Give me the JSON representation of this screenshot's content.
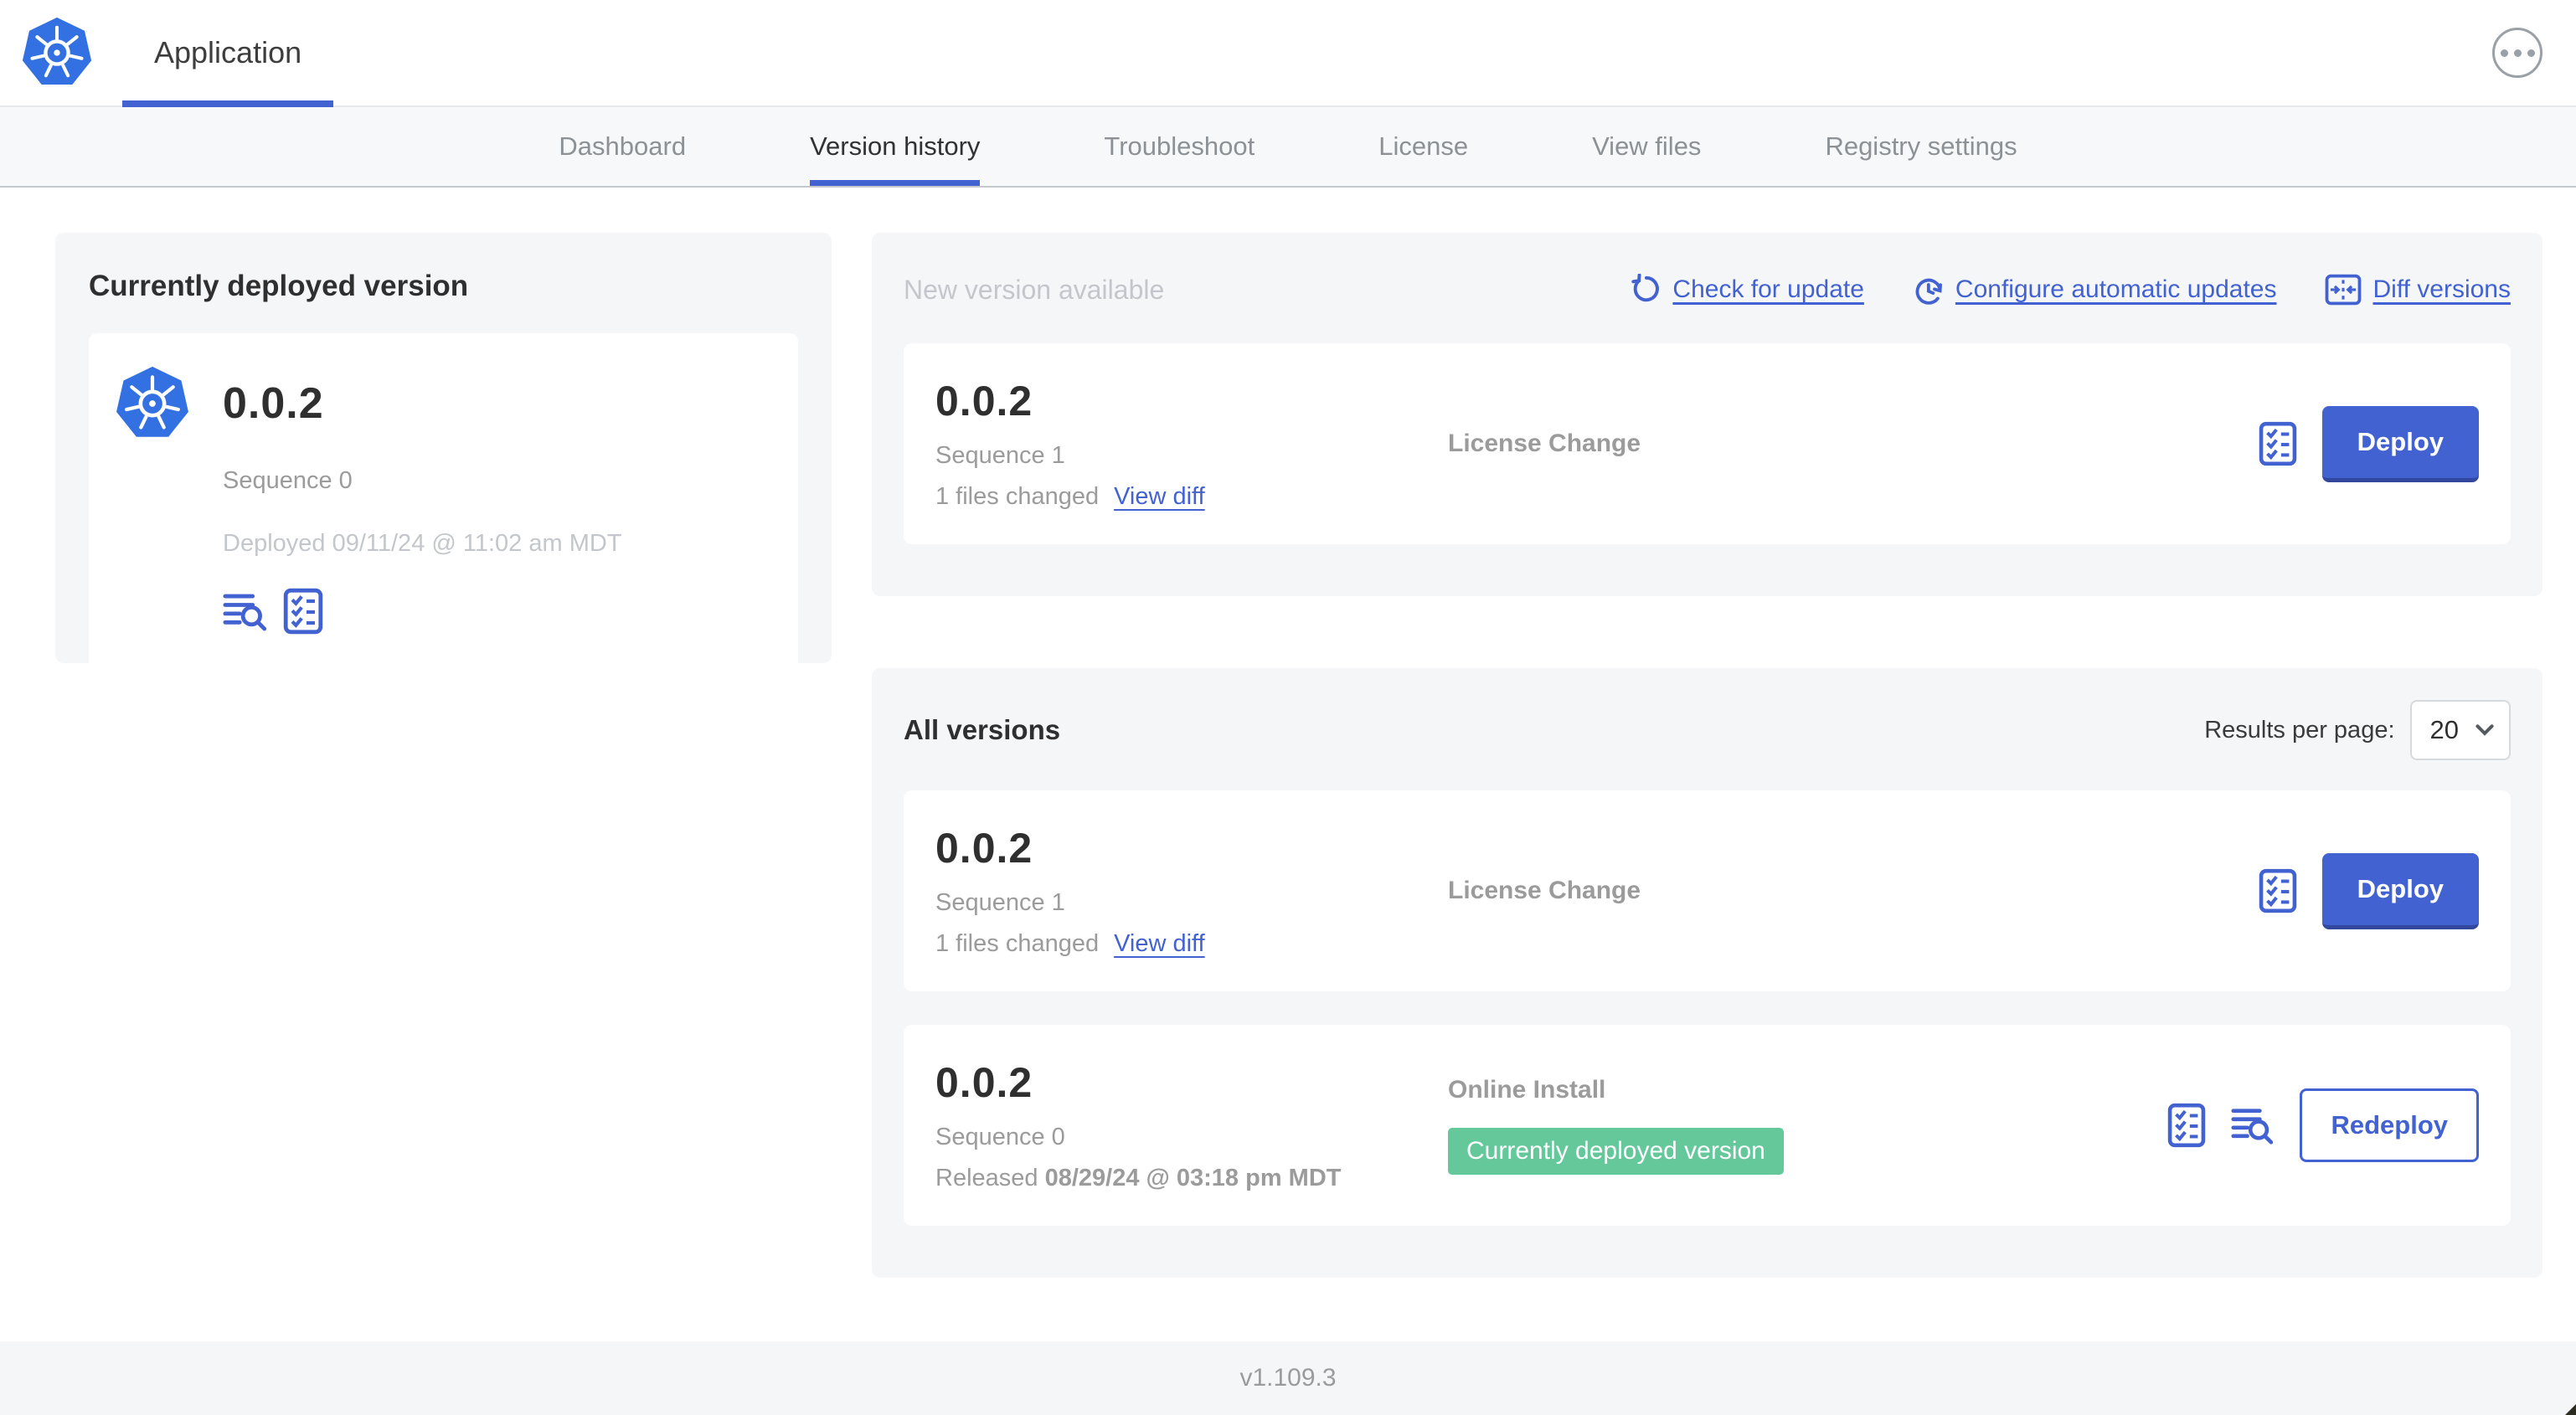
{
  "colors": {
    "primary_blue": "#4262d1",
    "primary_blue_dark": "#32479e",
    "logo_blue": "#3371e3",
    "badge_green": "#65c89b",
    "text_dark": "#2f2f2f",
    "text_gray": "#9b9b9b",
    "text_muted": "#c3c7cb",
    "panel_bg": "#f5f6f8"
  },
  "header": {
    "title": "Application"
  },
  "nav": {
    "tabs": [
      {
        "label": "Dashboard"
      },
      {
        "label": "Version history"
      },
      {
        "label": "Troubleshoot"
      },
      {
        "label": "License"
      },
      {
        "label": "View files"
      },
      {
        "label": "Registry settings"
      }
    ]
  },
  "current": {
    "title": "Currently deployed version",
    "version": "0.0.2",
    "sequence": "Sequence 0",
    "deployed": "Deployed 09/11/24 @ 11:02 am MDT"
  },
  "new_version": {
    "title": "New version available",
    "check_link": "Check for update",
    "auto_link": "Configure automatic updates",
    "diff_link": "Diff versions",
    "card": {
      "version": "0.0.2",
      "sequence": "Sequence 1",
      "files_changed": "1 files changed",
      "view_diff": "View diff",
      "source": "License Change",
      "action": "Deploy"
    }
  },
  "all_versions": {
    "title": "All versions",
    "results_label": "Results per page:",
    "results_value": "20",
    "rows": [
      {
        "version": "0.0.2",
        "sequence": "Sequence 1",
        "files_changed": "1 files changed",
        "view_diff": "View diff",
        "source": "License Change",
        "action": "Deploy"
      },
      {
        "version": "0.0.2",
        "sequence": "Sequence 0",
        "released_prefix": "Released ",
        "released_date": "08/29/24 @ 03:18 pm MDT",
        "source": "Online Install",
        "badge": "Currently deployed version",
        "action": "Redeploy"
      }
    ]
  },
  "footer": {
    "version": "v1.109.3"
  }
}
